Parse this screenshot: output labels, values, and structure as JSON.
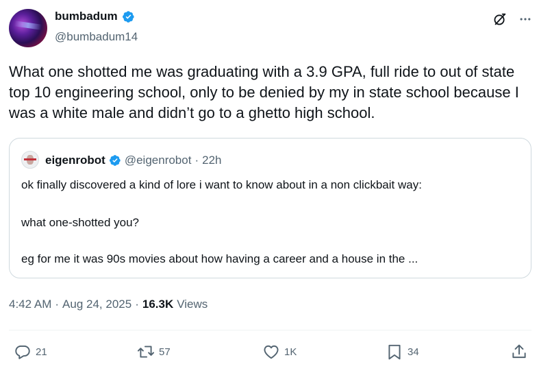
{
  "author": {
    "display_name": "bumbadum",
    "handle": "@bumbadum14"
  },
  "tweet": {
    "text": "What one shotted me was graduating with a 3.9 GPA, full ride to out of state top 10 engineering school, only to be denied by my in state school because I was a white male and didn’t go to a ghetto high school."
  },
  "quote": {
    "display_name": "eigenrobot",
    "handle": "@eigenrobot",
    "separator": "·",
    "time": "22h",
    "lines": [
      "ok finally discovered a kind of lore i want to know about in a non clickbait way:",
      "what one-shotted you?",
      "eg for me it was 90s movies about how having a career and a house in the ..."
    ]
  },
  "meta": {
    "time": "4:42 AM",
    "sep1": "·",
    "date": "Aug 24, 2025",
    "sep2": "·",
    "views_count": "16.3K",
    "views_label": "Views"
  },
  "actions": {
    "replies": "21",
    "reposts": "57",
    "likes": "1K",
    "bookmarks": "34"
  },
  "icons": {
    "verified": "verified-badge-icon",
    "grok": "grok-icon",
    "more": "more-icon",
    "reply": "reply-icon",
    "repost": "repost-icon",
    "like": "heart-icon",
    "bookmark": "bookmark-icon",
    "share": "share-icon"
  },
  "colors": {
    "verified_blue": "#1d9bf0",
    "text_primary": "#0f1419",
    "text_secondary": "#536471",
    "border": "#cfd9de"
  }
}
